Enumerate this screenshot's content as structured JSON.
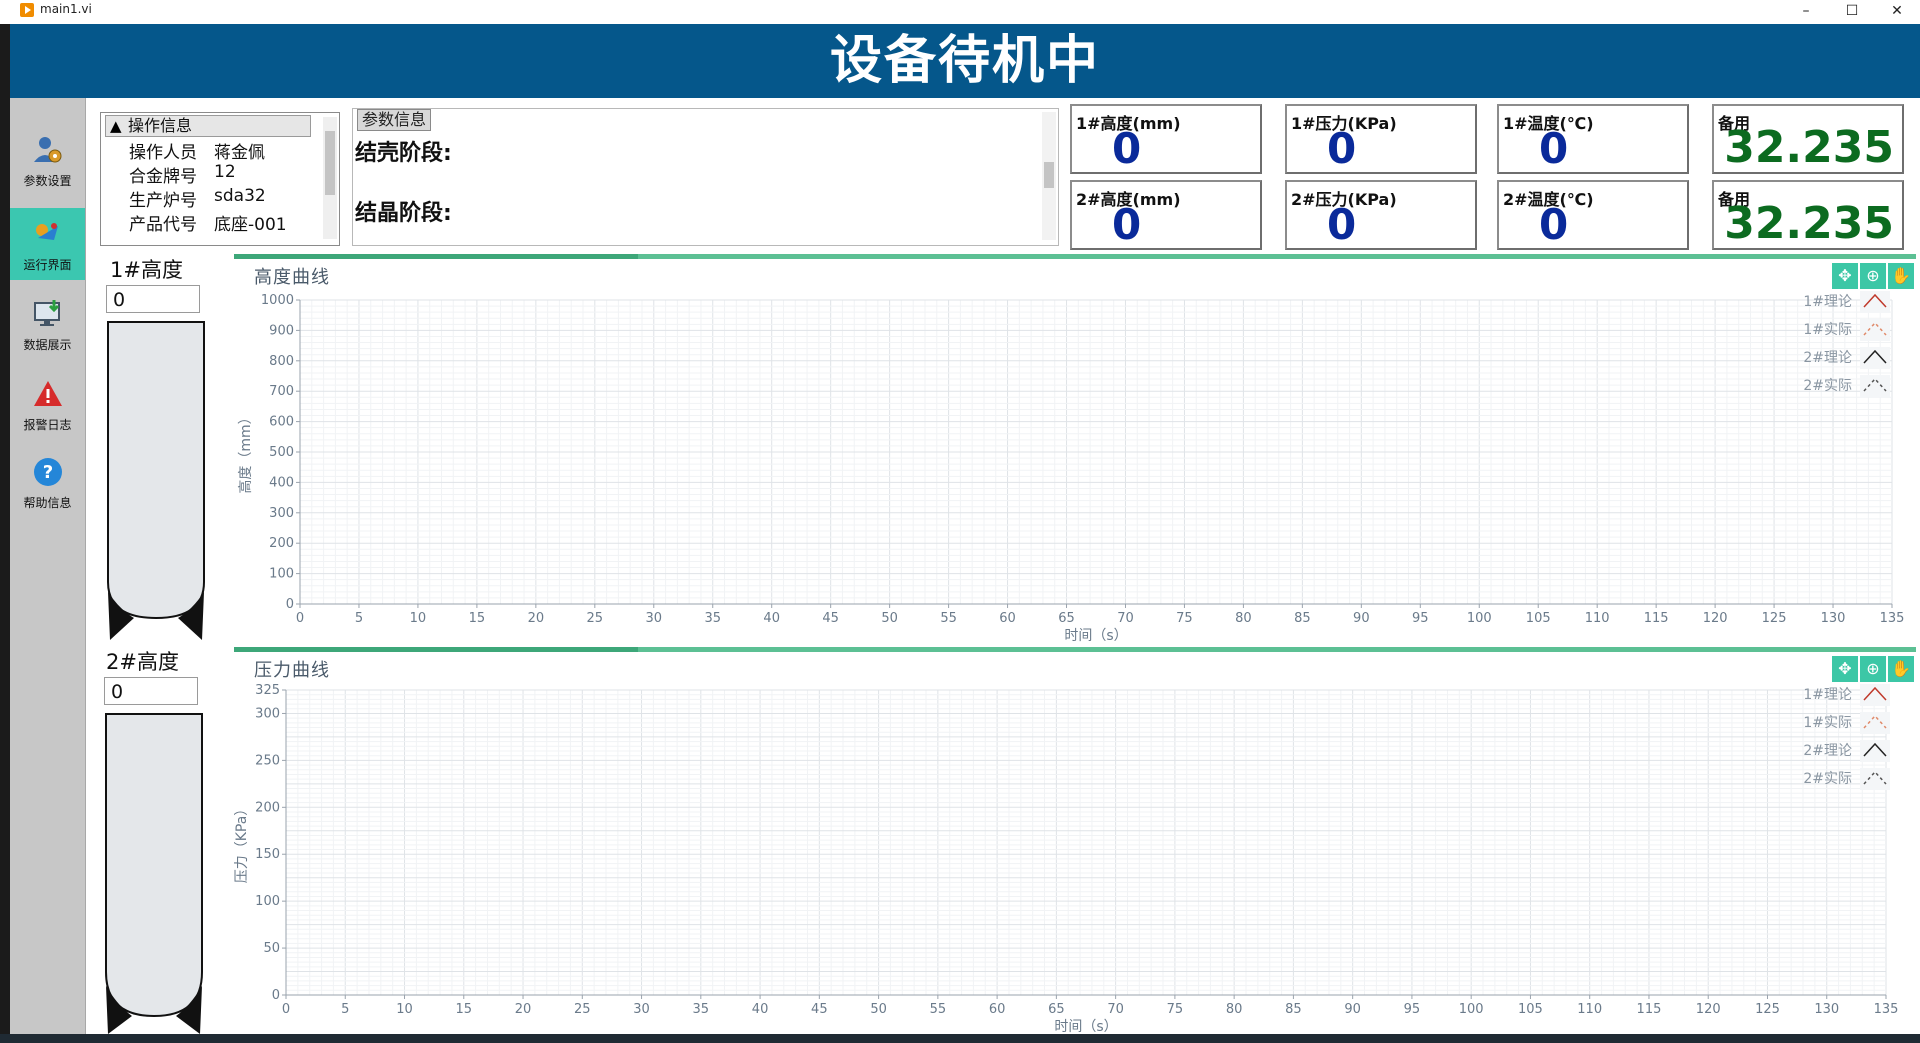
{
  "window": {
    "title": "main1.vi",
    "minimize": "–",
    "maximize": "☐",
    "close": "✕"
  },
  "header": {
    "title": "设备待机中"
  },
  "sidebar": {
    "items": [
      {
        "label": "参数设置",
        "icon": "user-settings-icon"
      },
      {
        "label": "运行界面",
        "icon": "run-interface-icon",
        "active": true
      },
      {
        "label": "数据展示",
        "icon": "data-display-icon"
      },
      {
        "label": "报警日志",
        "icon": "alarm-warning-icon"
      },
      {
        "label": "帮助信息",
        "icon": "help-icon"
      }
    ]
  },
  "info": {
    "header": "操作信息",
    "sort_glyph": "▲",
    "rows": [
      {
        "key": "操作人员",
        "value": "蒋金佩"
      },
      {
        "key": "合金牌号",
        "value": "12"
      },
      {
        "key": "生产炉号",
        "value": "sda32"
      },
      {
        "key": "产品代号",
        "value": "底座-001"
      }
    ]
  },
  "params": {
    "tag": "参数信息",
    "stage1": "结壳阶段:",
    "stage2": "结晶阶段:"
  },
  "readouts": [
    {
      "label": "1#高度(mm)",
      "value": "0"
    },
    {
      "label": "1#压力(KPa)",
      "value": "0"
    },
    {
      "label": "1#温度(℃)",
      "value": "0"
    },
    {
      "label": "备用",
      "value": "32.235"
    },
    {
      "label": "2#高度(mm)",
      "value": "0"
    },
    {
      "label": "2#压力(KPa)",
      "value": "0"
    },
    {
      "label": "2#温度(℃)",
      "value": "0"
    },
    {
      "label": "备用",
      "value": "32.235"
    }
  ],
  "tanks": [
    {
      "title": "1#高度",
      "value": "0"
    },
    {
      "title": "2#高度",
      "value": "0"
    }
  ],
  "chart_data": [
    {
      "type": "line",
      "title": "高度曲线",
      "xlabel": "时间（s）",
      "ylabel": "高度（mm）",
      "xlim": [
        0,
        135
      ],
      "ylim": [
        0,
        1000
      ],
      "xticks": [
        0,
        5,
        10,
        15,
        20,
        25,
        30,
        35,
        40,
        45,
        50,
        55,
        60,
        65,
        70,
        75,
        80,
        85,
        90,
        95,
        100,
        105,
        110,
        115,
        120,
        125,
        130,
        135
      ],
      "yticks": [
        0,
        100,
        200,
        300,
        400,
        500,
        600,
        700,
        800,
        900,
        1000
      ],
      "grid": true,
      "legend_position": "top-right",
      "series": [
        {
          "name": "1#理论",
          "color": "#c0392b",
          "style": "solid",
          "values": []
        },
        {
          "name": "1#实际",
          "color": "#e08a6a",
          "style": "dashed",
          "values": []
        },
        {
          "name": "2#理论",
          "color": "#222222",
          "style": "solid",
          "values": []
        },
        {
          "name": "2#实际",
          "color": "#555555",
          "style": "dashed",
          "values": []
        }
      ]
    },
    {
      "type": "line",
      "title": "压力曲线",
      "xlabel": "时间（s）",
      "ylabel": "压力（KPa）",
      "xlim": [
        0,
        135
      ],
      "ylim": [
        0,
        325
      ],
      "xticks": [
        0,
        5,
        10,
        15,
        20,
        25,
        30,
        35,
        40,
        45,
        50,
        55,
        60,
        65,
        70,
        75,
        80,
        85,
        90,
        95,
        100,
        105,
        110,
        115,
        120,
        125,
        130,
        135
      ],
      "yticks": [
        0,
        50,
        100,
        150,
        200,
        250,
        300,
        325
      ],
      "grid": true,
      "legend_position": "top-right",
      "series": [
        {
          "name": "1#理论",
          "color": "#c0392b",
          "style": "solid",
          "values": []
        },
        {
          "name": "1#实际",
          "color": "#e08a6a",
          "style": "dashed",
          "values": []
        },
        {
          "name": "2#理论",
          "color": "#222222",
          "style": "solid",
          "values": []
        },
        {
          "name": "2#实际",
          "color": "#555555",
          "style": "dashed",
          "values": []
        }
      ]
    }
  ],
  "chart_tools": {
    "cursor": "✥",
    "zoom": "⊕",
    "pan": "✋"
  }
}
